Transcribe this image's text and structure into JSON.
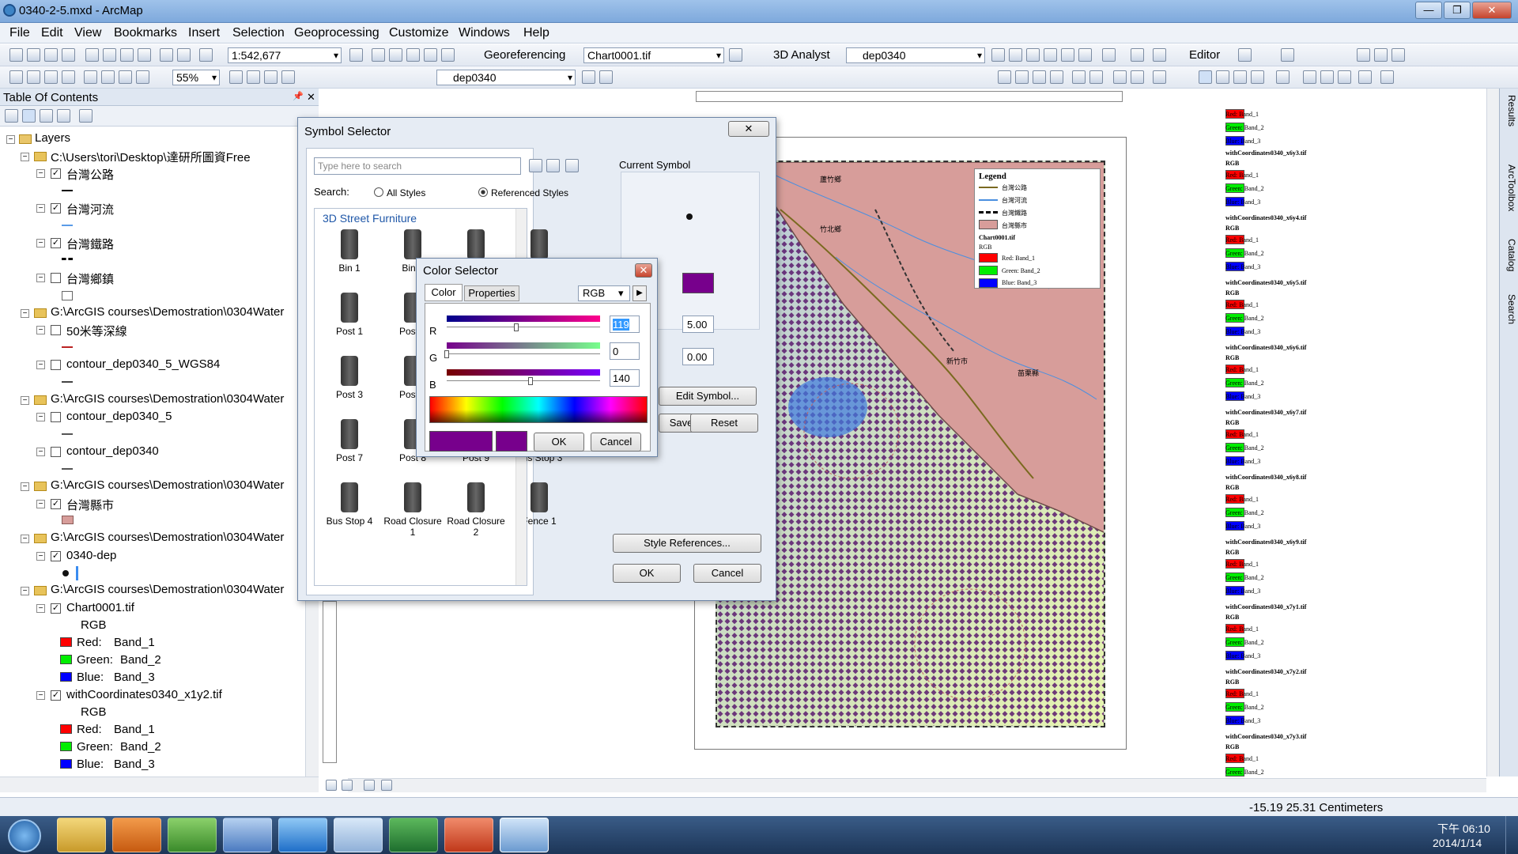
{
  "window": {
    "title": "0340-2-5.mxd - ArcMap",
    "min": "—",
    "max": "❐",
    "close": "✕"
  },
  "menu": [
    "File",
    "Edit",
    "View",
    "Bookmarks",
    "Insert",
    "Selection",
    "Geoprocessing",
    "Customize",
    "Windows",
    "Help"
  ],
  "toolbar1": {
    "scale": "1:542,677",
    "georef_label": "Georeferencing",
    "georef_layer": "Chart0001.tif",
    "analyst_label": "3D Analyst",
    "analyst_layer": "dep0340",
    "editor_label": "Editor"
  },
  "toolbar2": {
    "zoom": "55%",
    "layer": "dep0340"
  },
  "toc": {
    "header": "Table Of Contents",
    "pin": "📌",
    "close": "✕",
    "root": "Layers",
    "groups": [
      {
        "path": "C:\\Users\\tori\\Desktop\\達研所圖資Free",
        "layers": [
          {
            "name": "台灣公路",
            "checked": true
          },
          {
            "name": "台灣河流",
            "checked": true
          },
          {
            "name": "台灣鐵路",
            "checked": true
          },
          {
            "name": "台灣鄉鎮",
            "checked": false
          }
        ]
      },
      {
        "path": "G:\\ArcGIS courses\\Demostration\\0304Water",
        "layers": [
          {
            "name": "50米等深線",
            "checked": false
          },
          {
            "name": "contour_dep0340_5_WGS84",
            "checked": false
          }
        ]
      },
      {
        "path": "G:\\ArcGIS courses\\Demostration\\0304Water",
        "layers": [
          {
            "name": "contour_dep0340_5",
            "checked": false
          },
          {
            "name": "contour_dep0340",
            "checked": false
          }
        ]
      },
      {
        "path": "G:\\ArcGIS courses\\Demostration\\0304Water",
        "layers": [
          {
            "name": "台灣縣市",
            "checked": true
          }
        ]
      },
      {
        "path": "G:\\ArcGIS courses\\Demostration\\0304Water",
        "layers": [
          {
            "name": "0340-dep",
            "checked": true
          }
        ]
      },
      {
        "path": "G:\\ArcGIS courses\\Demostration\\0304Water",
        "layers": [
          {
            "name": "Chart0001.tif",
            "checked": true
          },
          {
            "name": "withCoordinates0340_x1y2.tif",
            "checked": true
          }
        ]
      }
    ],
    "rgb_label": "RGB",
    "red": "Red:",
    "green": "Green:",
    "blue": "Blue:",
    "band1": "Band_1",
    "band2": "Band_2",
    "band3": "Band_3"
  },
  "symbol_selector": {
    "title": "Symbol Selector",
    "search_placeholder": "Type here to search",
    "search_label": "Search:",
    "all_styles": "All Styles",
    "referenced_styles": "Referenced Styles",
    "category": "3D Street Furniture",
    "current_symbol": "Current Symbol",
    "items": [
      "Bin 1",
      "Bin 2",
      "",
      "",
      "Post 1",
      "Post 2",
      "",
      "",
      "Post 3",
      "Post 4",
      "",
      "",
      "Post 7",
      "Post 8",
      "Post 9",
      "Bus Stop 3",
      "Bus Stop 4",
      "Road Closure 1",
      "Road Closure 2",
      "Fence 1"
    ],
    "size": "5.00",
    "angle": "0.00",
    "edit_symbol": "Edit Symbol...",
    "save_as": "Save As...",
    "reset": "Reset",
    "style_refs": "Style References...",
    "ok": "OK",
    "cancel": "Cancel"
  },
  "color_selector": {
    "title": "Color Selector",
    "tab_color": "Color",
    "tab_properties": "Properties",
    "model": "RGB",
    "r_label": "R",
    "g_label": "G",
    "b_label": "B",
    "r": "119",
    "g": "0",
    "b": "140",
    "ok": "OK",
    "cancel": "Cancel",
    "swatch": "#77008c"
  },
  "map_legend": {
    "title": "Legend",
    "items": [
      "台灣公路",
      "台灣河流",
      "台灣鐵路",
      "台灣縣市"
    ],
    "chart": "Chart0001.tif",
    "rgb": "RGB",
    "red": "Red: Band_1",
    "green": "Green: Band_2",
    "blue": "Blue: Band_3",
    "towns": [
      "蘆竹鄉",
      "竹北鄉",
      "苗栗縣",
      "新竹市"
    ]
  },
  "side_legend": {
    "layers": [
      "withCoordinates0340_x6y3.tif",
      "withCoordinates0340_x6y4.tif",
      "withCoordinates0340_x6y5.tif",
      "withCoordinates0340_x6y6.tif",
      "withCoordinates0340_x6y7.tif",
      "withCoordinates0340_x6y8.tif",
      "withCoordinates0340_x6y9.tif",
      "withCoordinates0340_x7y1.tif",
      "withCoordinates0340_x7y2.tif",
      "withCoordinates0340_x7y3.tif"
    ],
    "rgb": "RGB",
    "red": "Red: Band_1",
    "green": "Green: Band_2",
    "blue": "Blue: Band_3"
  },
  "right_dock": [
    "Results",
    "ArcToolbox",
    "Catalog",
    "Search"
  ],
  "status": {
    "coords": "-15.19  25.31 Centimeters"
  },
  "taskbar": {
    "time": "下午 06:10",
    "date": "2014/1/14"
  },
  "colors": {
    "red": "#ff0000",
    "green": "#00ee00",
    "blue": "#0000ff",
    "purple": "#77008c",
    "county": "#d79d9a"
  }
}
